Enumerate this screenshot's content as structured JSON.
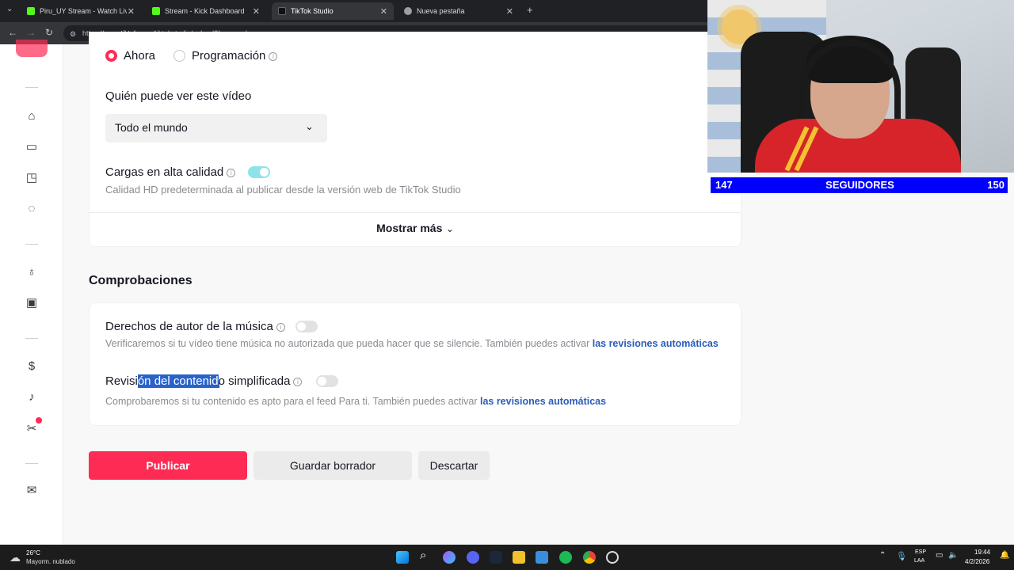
{
  "browser": {
    "tabs": [
      {
        "title": "Piru_UY Stream - Watch Live on",
        "color": "#53fc18"
      },
      {
        "title": "Stream - Kick Dashboard",
        "color": "#53fc18"
      },
      {
        "title": "TikTok Studio",
        "color": "#111111"
      },
      {
        "title": "Nueva pestaña",
        "color": "#9aa0a6"
      }
    ],
    "url_prefix": "https://",
    "url_domain": "www.tiktok.com",
    "url_path": "/tiktokstudio/upload?from=webapp"
  },
  "schedule": {
    "option_now": "Ahora",
    "option_scheduled": "Programación"
  },
  "visibility": {
    "label": "Quién puede ver este vídeo",
    "selected": "Todo el mundo"
  },
  "hd": {
    "label": "Cargas en alta calidad",
    "desc": "Calidad HD predeterminada al publicar desde la versión web de TikTok Studio",
    "enabled": true
  },
  "show_more": "Mostrar más",
  "checks": {
    "title": "Comprobaciones",
    "music": {
      "label": "Derechos de autor de la música",
      "desc": "Verificaremos si tu vídeo tiene música no autorizada que pueda hacer que se silencie. También puedes activar ",
      "link": "las revisiones automáticas",
      "enabled": false
    },
    "content": {
      "label_a": "Revisi",
      "label_sel": "ón del contenid",
      "label_b": "o simplificada",
      "desc": "Comprobaremos si tu contenido es apto para el feed Para ti. También puedes activar ",
      "link": "las revisiones automáticas",
      "enabled": false
    }
  },
  "actions": {
    "publish": "Publicar",
    "save_draft": "Guardar borrador",
    "discard": "Descartar"
  },
  "overlay": {
    "left_count": "147",
    "label": "SEGUIDORES",
    "right_count": "150"
  },
  "taskbar": {
    "temp": "26°C",
    "weather": "Mayorm. nublado",
    "lang": "ESP",
    "lang2": "LAA",
    "time": "19:44",
    "date": "4/2/2026"
  },
  "colors": {
    "accent": "#fe2c55",
    "link": "#2b5db8",
    "counter_bg": "#0000ff"
  }
}
